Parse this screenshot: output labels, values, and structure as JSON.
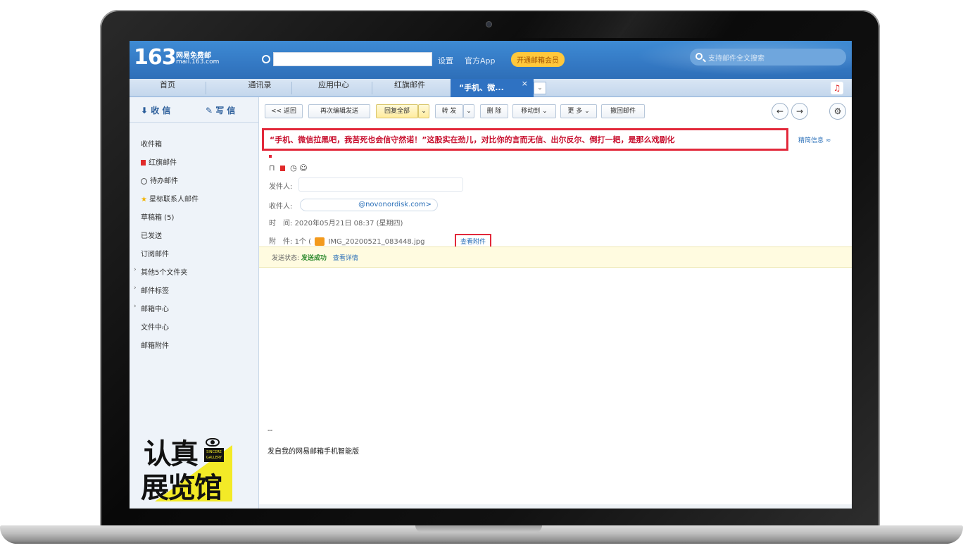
{
  "header": {
    "logo_number": "163",
    "logo_title": "网易免费邮",
    "logo_domain": "mail.163.com",
    "links": [
      "设置",
      "官方App"
    ],
    "vip_label": "开通邮箱会员",
    "search_placeholder": "支持邮件全文搜索"
  },
  "tabs": [
    {
      "label": "首页"
    },
    {
      "label": "通讯录"
    },
    {
      "label": "应用中心"
    },
    {
      "label": "红旗邮件"
    }
  ],
  "active_tab": {
    "label": "“手机、微...",
    "close": "×",
    "more": "⌄"
  },
  "sidebar": {
    "receive_label": "收 信",
    "compose_label": "写 信",
    "items": [
      {
        "label": "收件箱"
      },
      {
        "label": "红旗邮件"
      },
      {
        "label": "待办邮件"
      },
      {
        "label": "星标联系人邮件"
      },
      {
        "label": "草稿箱 (5)"
      },
      {
        "label": "已发送"
      },
      {
        "label": "订阅邮件"
      },
      {
        "label": "其他5个文件夹"
      },
      {
        "label": "邮件标签"
      },
      {
        "label": "邮箱中心"
      },
      {
        "label": "文件中心"
      },
      {
        "label": "邮箱附件"
      }
    ],
    "promo": {
      "line1": "认真",
      "line2": "展览馆",
      "badge": "SINCERE GALLERY"
    }
  },
  "toolbar": {
    "back": "<< 返回",
    "resend": "再次编辑发送",
    "reply_all": "回复全部",
    "forward": "转 发",
    "delete": "删 除",
    "move_to": "移动到",
    "more": "更 多",
    "recall": "撤回邮件",
    "prev": "←",
    "next": "→",
    "settings": "⚙"
  },
  "email": {
    "subject": "“手机、微信拉黑吧，我苦死也会信守然诺！”这股实在劲儿，对比你的言而无信、出尔反尔、倒打一耙，是那么戏剧化",
    "subject_side_link": "精简信息 ≈",
    "sender_label": "发件人:",
    "recipient_label": "收件人:",
    "recipient_value": "@novonordisk.com>",
    "time_label": "时　间:",
    "time_value": "2020年05月21日 08:37 (星期四)",
    "attach_label": "附　件:",
    "attach_prefix": "1个 (",
    "attach_file": "IMG_20200521_083448.jpg",
    "view_attach": "查看附件",
    "status_label": "发送状态:",
    "status_value": "发送成功",
    "status_link": "查看详情",
    "signature_dash": "--",
    "signature": "发自我的网易邮箱手机智能版"
  },
  "colors": {
    "brand_blue": "#3479c4",
    "highlight_red": "#e2283a",
    "vip_yellow": "#ffc83c"
  }
}
